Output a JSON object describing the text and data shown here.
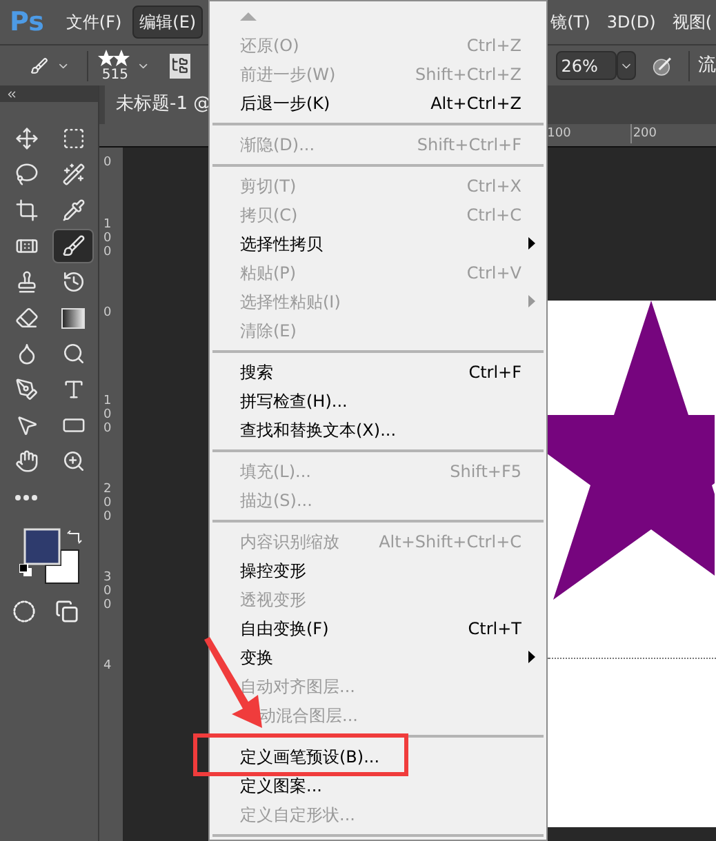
{
  "menu_bar": {
    "logo": "Ps",
    "items": [
      {
        "label": "文件(F)",
        "selected": false
      },
      {
        "label": "编辑(E)",
        "selected": true
      }
    ],
    "items_right": [
      "镜(T)",
      "3D(D)",
      "视图("
    ]
  },
  "options_bar": {
    "brush_size": "515",
    "opacity": "26%",
    "flow_label": "流"
  },
  "document_tab": {
    "title": "未标题-1 @"
  },
  "tools": [
    {
      "selected": false
    },
    {
      "selected": false
    },
    {
      "selected": false
    },
    {
      "selected": false
    },
    {
      "selected": false
    },
    {
      "selected": false
    },
    {
      "selected": false
    },
    {
      "selected": true
    },
    {
      "selected": false
    },
    {
      "selected": false
    },
    {
      "selected": false
    },
    {
      "selected": false
    },
    {
      "selected": false
    },
    {
      "selected": false
    },
    {
      "selected": false
    },
    {
      "selected": false
    },
    {
      "selected": false
    },
    {
      "selected": false
    },
    {
      "selected": false
    },
    {
      "selected": false
    },
    {
      "selected": false
    }
  ],
  "color_swatches": [
    {
      "color": "#2e3b6d"
    },
    {
      "color": "#ffffff"
    }
  ],
  "horizontal_ruler": [
    "100",
    "200"
  ],
  "vertical_ruler": [
    "0",
    "100",
    "0",
    "100",
    "200",
    "300",
    "4"
  ],
  "edit_menu": [
    {
      "kind": "item",
      "label": "还原(O)",
      "shortcut": "Ctrl+Z",
      "disabled": true,
      "submenu": false
    },
    {
      "kind": "item",
      "label": "前进一步(W)",
      "shortcut": "Shift+Ctrl+Z",
      "disabled": true,
      "submenu": false
    },
    {
      "kind": "item",
      "label": "后退一步(K)",
      "shortcut": "Alt+Ctrl+Z",
      "disabled": false,
      "submenu": false
    },
    {
      "kind": "separator"
    },
    {
      "kind": "item",
      "label": "渐隐(D)...",
      "shortcut": "Shift+Ctrl+F",
      "disabled": true,
      "submenu": false
    },
    {
      "kind": "separator"
    },
    {
      "kind": "item",
      "label": "剪切(T)",
      "shortcut": "Ctrl+X",
      "disabled": true,
      "submenu": false
    },
    {
      "kind": "item",
      "label": "拷贝(C)",
      "shortcut": "Ctrl+C",
      "disabled": true,
      "submenu": false
    },
    {
      "kind": "item",
      "label": "选择性拷贝",
      "disabled": false,
      "submenu": true
    },
    {
      "kind": "item",
      "label": "粘贴(P)",
      "shortcut": "Ctrl+V",
      "disabled": true,
      "submenu": false
    },
    {
      "kind": "item",
      "label": "选择性粘贴(I)",
      "disabled": true,
      "submenu": true
    },
    {
      "kind": "item",
      "label": "清除(E)",
      "disabled": true,
      "submenu": false
    },
    {
      "kind": "separator"
    },
    {
      "kind": "item",
      "label": "搜索",
      "shortcut": "Ctrl+F",
      "disabled": false,
      "submenu": false
    },
    {
      "kind": "item",
      "label": "拼写检查(H)...",
      "disabled": false,
      "submenu": false
    },
    {
      "kind": "item",
      "label": "查找和替换文本(X)...",
      "disabled": false,
      "submenu": false
    },
    {
      "kind": "separator"
    },
    {
      "kind": "item",
      "label": "填充(L)...",
      "shortcut": "Shift+F5",
      "disabled": true,
      "submenu": false
    },
    {
      "kind": "item",
      "label": "描边(S)...",
      "disabled": true,
      "submenu": false
    },
    {
      "kind": "separator"
    },
    {
      "kind": "item",
      "label": "内容识别缩放",
      "shortcut": "Alt+Shift+Ctrl+C",
      "disabled": true,
      "submenu": false
    },
    {
      "kind": "item",
      "label": "操控变形",
      "disabled": false,
      "submenu": false
    },
    {
      "kind": "item",
      "label": "透视变形",
      "disabled": true,
      "submenu": false
    },
    {
      "kind": "item",
      "label": "自由变换(F)",
      "shortcut": "Ctrl+T",
      "disabled": false,
      "submenu": false
    },
    {
      "kind": "item",
      "label": "变换",
      "disabled": false,
      "submenu": true
    },
    {
      "kind": "item",
      "label": "自动对齐图层...",
      "disabled": true,
      "submenu": false
    },
    {
      "kind": "item",
      "label": "动混合图层...",
      "disabled": true,
      "submenu": false,
      "covered_by_arrow": true
    },
    {
      "kind": "separator"
    },
    {
      "kind": "item",
      "label": "定义画笔预设(B)...",
      "disabled": false,
      "submenu": false
    },
    {
      "kind": "item",
      "label": "定义图案...",
      "disabled": false,
      "submenu": false
    },
    {
      "kind": "item",
      "label": "定义自定形状...",
      "disabled": true,
      "submenu": false
    },
    {
      "kind": "separator"
    }
  ]
}
